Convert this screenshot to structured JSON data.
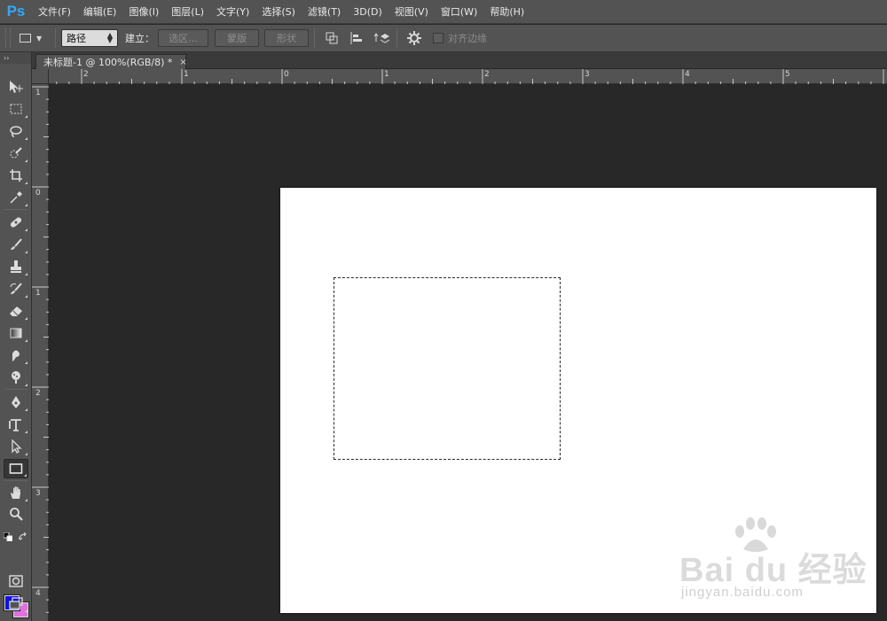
{
  "app": {
    "logo": "Ps"
  },
  "menu": [
    {
      "label": "文件(F)"
    },
    {
      "label": "编辑(E)"
    },
    {
      "label": "图像(I)"
    },
    {
      "label": "图层(L)"
    },
    {
      "label": "文字(Y)"
    },
    {
      "label": "选择(S)"
    },
    {
      "label": "滤镜(T)"
    },
    {
      "label": "3D(D)"
    },
    {
      "label": "视图(V)"
    },
    {
      "label": "窗口(W)"
    },
    {
      "label": "帮助(H)"
    }
  ],
  "options": {
    "mode_select": "路径",
    "make_label": "建立：",
    "selection_button": "选区...",
    "mask_button": "蒙版",
    "shape_button": "形状",
    "align_edges_label": "对齐边缘",
    "align_edges_checked": false
  },
  "document": {
    "tab_title": "未标题-1 @ 100%(RGB/8) *",
    "close_glyph": "×"
  },
  "rulers": {
    "top_labels": [
      "2",
      "1",
      "0",
      "1",
      "2",
      "3",
      "4",
      "5"
    ],
    "left_labels": [
      "1",
      "0",
      "1",
      "2",
      "3",
      "4"
    ]
  },
  "colors": {
    "foreground": "#1010e0",
    "background": "#e070e0",
    "app_bg": "#282828",
    "panel": "#535353",
    "accent": "#31a8ff"
  },
  "watermark": {
    "brand": "Bai du 经验",
    "url": "jingyan.baidu.com"
  },
  "tools": [
    {
      "name": "move-tool-icon"
    },
    {
      "name": "marquee-tool-icon"
    },
    {
      "name": "lasso-tool-icon"
    },
    {
      "name": "quick-selection-tool-icon"
    },
    {
      "name": "crop-tool-icon"
    },
    {
      "name": "eyedropper-tool-icon"
    },
    {
      "name": "healing-brush-tool-icon"
    },
    {
      "name": "brush-tool-icon"
    },
    {
      "name": "clone-stamp-tool-icon"
    },
    {
      "name": "history-brush-tool-icon"
    },
    {
      "name": "eraser-tool-icon"
    },
    {
      "name": "gradient-tool-icon"
    },
    {
      "name": "blur-tool-icon"
    },
    {
      "name": "dodge-tool-icon"
    },
    {
      "name": "pen-tool-icon"
    },
    {
      "name": "type-tool-icon"
    },
    {
      "name": "path-selection-tool-icon"
    },
    {
      "name": "rectangle-tool-icon"
    },
    {
      "name": "hand-tool-icon"
    },
    {
      "name": "zoom-tool-icon"
    }
  ]
}
